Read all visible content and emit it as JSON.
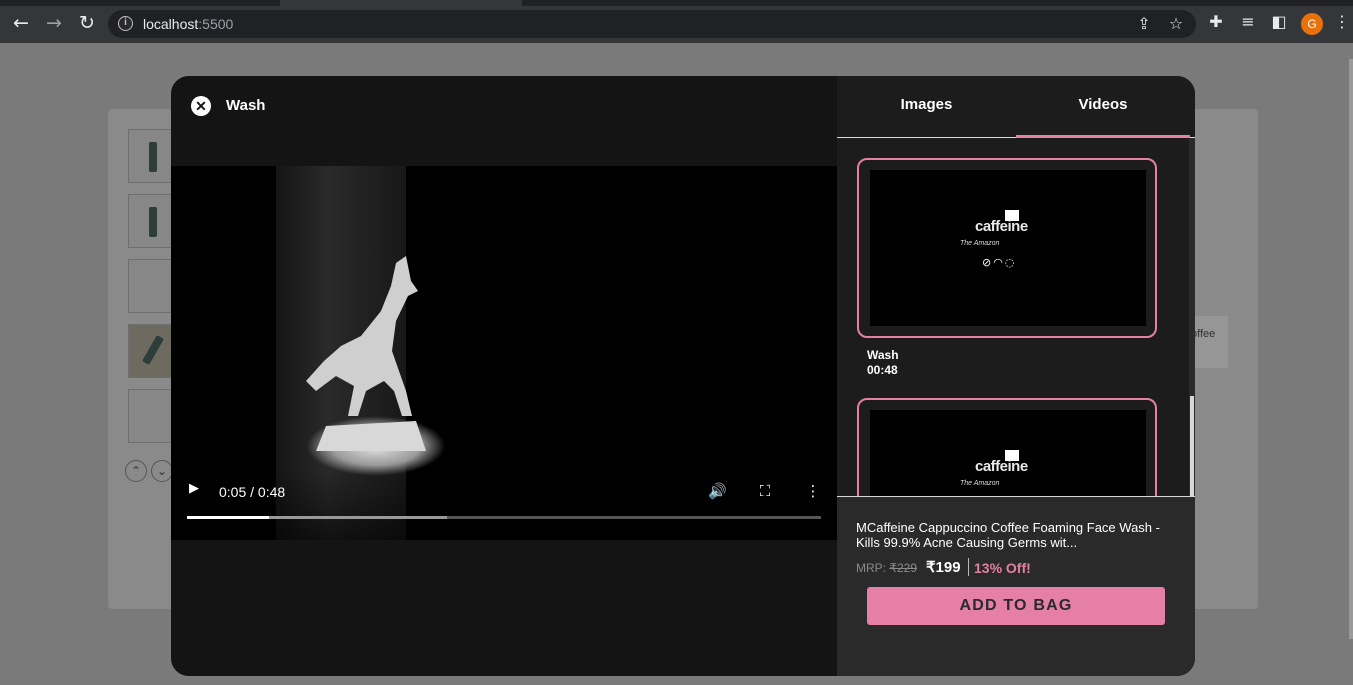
{
  "browser": {
    "url_host": "localhost",
    "url_port": ":5500",
    "avatar_letter": "G"
  },
  "page_behind": {
    "coffee_text": "offee"
  },
  "modal": {
    "title": "Wash",
    "close_icon": "close-icon",
    "video": {
      "time_display": "0:05 / 0:48",
      "progress_fraction": 0.13,
      "buffered_fraction": 0.41
    },
    "tabs": [
      {
        "label": "Images",
        "active": false
      },
      {
        "label": "Videos",
        "active": true
      }
    ],
    "video_list": [
      {
        "name": "Wash",
        "duration": "00:48",
        "logo": "caffeine",
        "tagline": "The Amazon"
      },
      {
        "name": "",
        "duration": "",
        "logo": "caffeine",
        "tagline": "The Amazon"
      }
    ],
    "product": {
      "name": "MCaffeine Cappuccino Coffee Foaming Face Wash - Kills 99.9% Acne Causing Germs wit...",
      "mrp_label": "MRP:",
      "mrp_value": "₹229",
      "price": "₹199",
      "discount": "13% Off!",
      "add_to_bag": "ADD TO BAG"
    }
  },
  "colors": {
    "accent": "#e67fa5",
    "modal_bg": "#141414",
    "panel_bg": "#2a2a2a"
  }
}
